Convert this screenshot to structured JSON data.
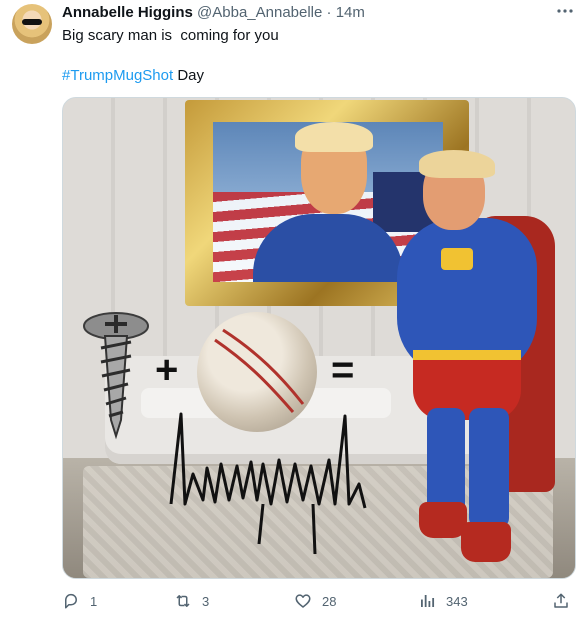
{
  "tweet": {
    "author_name": "Annabelle Higgins",
    "author_handle": "@Abba_Annabelle",
    "separator": "·",
    "timestamp": "14m",
    "text_line1": "Big scary man is  coming for you",
    "hashtag": "#TrumpMugShot",
    "text_line2_suffix": " Day",
    "more_icon": "more-horizontal-icon"
  },
  "media": {
    "plus_symbol": "+",
    "equals_symbol": "="
  },
  "actions": {
    "reply_count": "1",
    "retweet_count": "3",
    "like_count": "28",
    "view_count": "343"
  },
  "colors": {
    "link": "#1d9bf0",
    "secondary_text": "#536471",
    "primary_text": "#0f1419"
  }
}
